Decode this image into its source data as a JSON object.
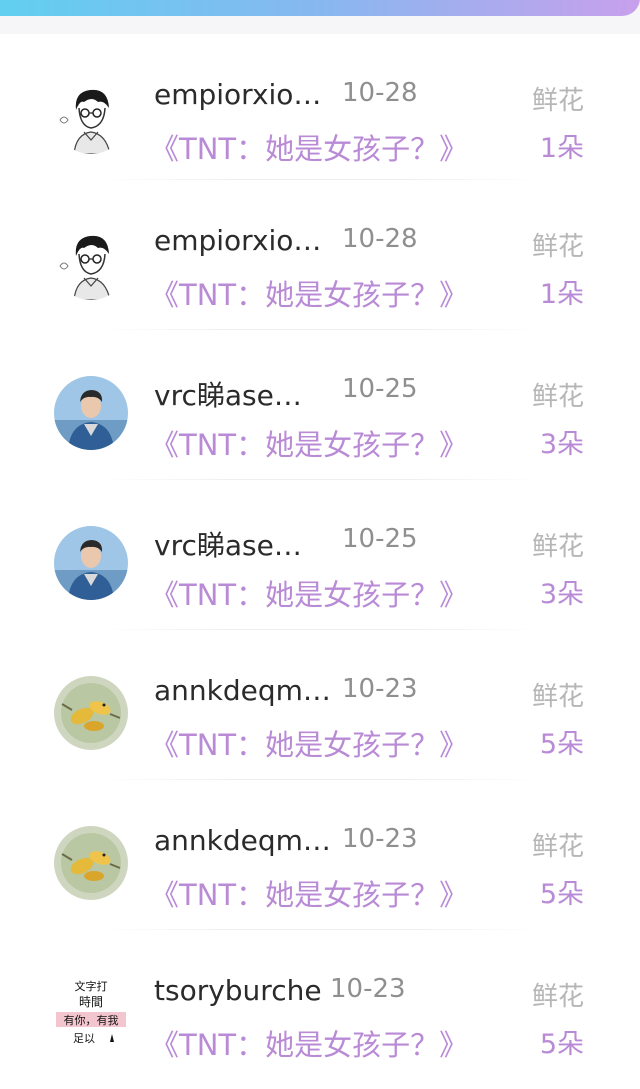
{
  "records": [
    {
      "username": "empiorxio…",
      "date": "10-28",
      "flower_label": "鲜花",
      "book": "《TNT：她是女孩子？》",
      "count": "1朵",
      "avatar": "sketch-boy-glasses"
    },
    {
      "username": "empiorxio…",
      "date": "10-28",
      "flower_label": "鲜花",
      "book": "《TNT：她是女孩子？》",
      "count": "1朵",
      "avatar": "sketch-boy-glasses"
    },
    {
      "username": "vrc睇ase…",
      "date": "10-25",
      "flower_label": "鲜花",
      "book": "《TNT：她是女孩子？》",
      "count": "3朵",
      "avatar": "boy-denim-jacket-photo"
    },
    {
      "username": "vrc睇ase…",
      "date": "10-25",
      "flower_label": "鲜花",
      "book": "《TNT：她是女孩子？》",
      "count": "3朵",
      "avatar": "boy-denim-jacket-photo"
    },
    {
      "username": "annkdeqm…",
      "date": "10-23",
      "flower_label": "鲜花",
      "book": "《TNT：她是女孩子？》",
      "count": "5朵",
      "avatar": "yellow-birds-photo"
    },
    {
      "username": "annkdeqm…",
      "date": "10-23",
      "flower_label": "鲜花",
      "book": "《TNT：她是女孩子？》",
      "count": "5朵",
      "avatar": "yellow-birds-photo"
    },
    {
      "username": "tsoryburche",
      "date": "10-23",
      "flower_label": "鲜花",
      "book": "《TNT：她是女孩子？》",
      "count": "5朵",
      "avatar": "text-image",
      "avatar_text": [
        "文字打",
        "時間",
        "有你，有我",
        "足以"
      ]
    }
  ],
  "colors": {
    "username": "#2b2b2b",
    "date": "#8f8f8f",
    "flower_label": "#b6b6b6",
    "accent_purple": "#b98ad6",
    "top_gradient": [
      "#5fd0f0",
      "#c8a0ec"
    ]
  }
}
